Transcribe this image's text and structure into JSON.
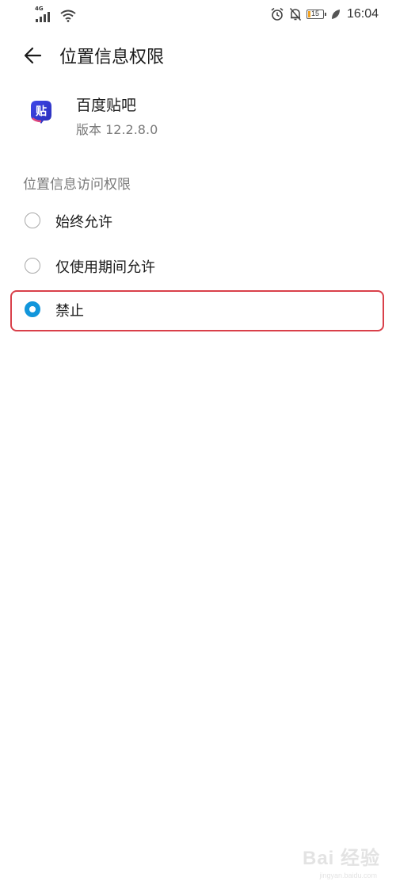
{
  "status_bar": {
    "network_type": "4G",
    "battery_level": 15,
    "battery_text": "15",
    "time": "16:04",
    "icons": [
      "signal-icon",
      "wifi-icon",
      "alarm-icon",
      "notifications-off-icon",
      "battery-icon",
      "eco-leaf-icon"
    ]
  },
  "header": {
    "back_icon": "back-arrow-icon",
    "title": "位置信息权限"
  },
  "app": {
    "icon": "baidu-tieba-app-icon",
    "icon_glyph": "贴",
    "name": "百度贴吧",
    "version": "版本 12.2.8.0"
  },
  "permission": {
    "section_title": "位置信息访问权限",
    "options": [
      {
        "label": "始终允许",
        "selected": false
      },
      {
        "label": "仅使用期间允许",
        "selected": false
      },
      {
        "label": "禁止",
        "selected": true
      }
    ]
  },
  "colors": {
    "accent": "#1296db",
    "highlight_border": "#d9404a",
    "secondary_text": "#7a7a7a",
    "battery_low": "#f2a221"
  },
  "watermark": {
    "logo": "Bai 经验",
    "url": "jingyan.baidu.com"
  }
}
